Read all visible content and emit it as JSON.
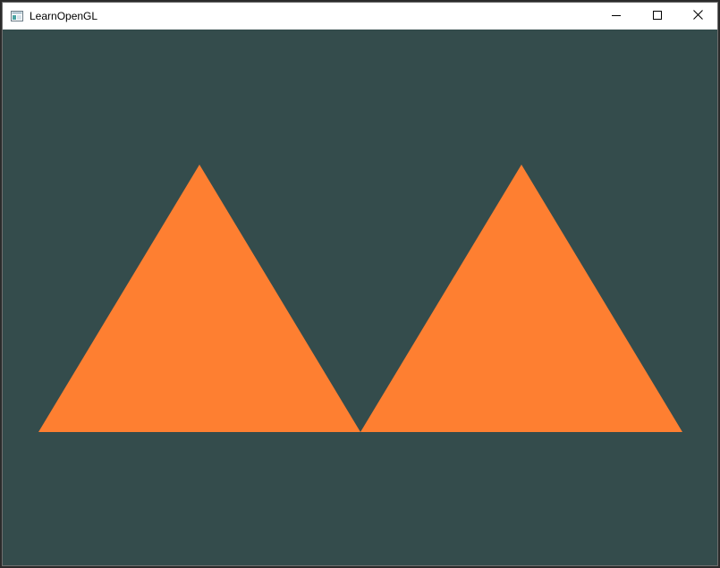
{
  "window": {
    "title": "LearnOpenGL",
    "icon": "app-window-icon",
    "controls": {
      "minimize_icon": "minimize-icon",
      "maximize_icon": "maximize-icon",
      "close_icon": "close-icon"
    }
  },
  "scene": {
    "clear_color": "#344c4c",
    "triangle_color": "#fe7f31",
    "triangle_count": 2
  }
}
